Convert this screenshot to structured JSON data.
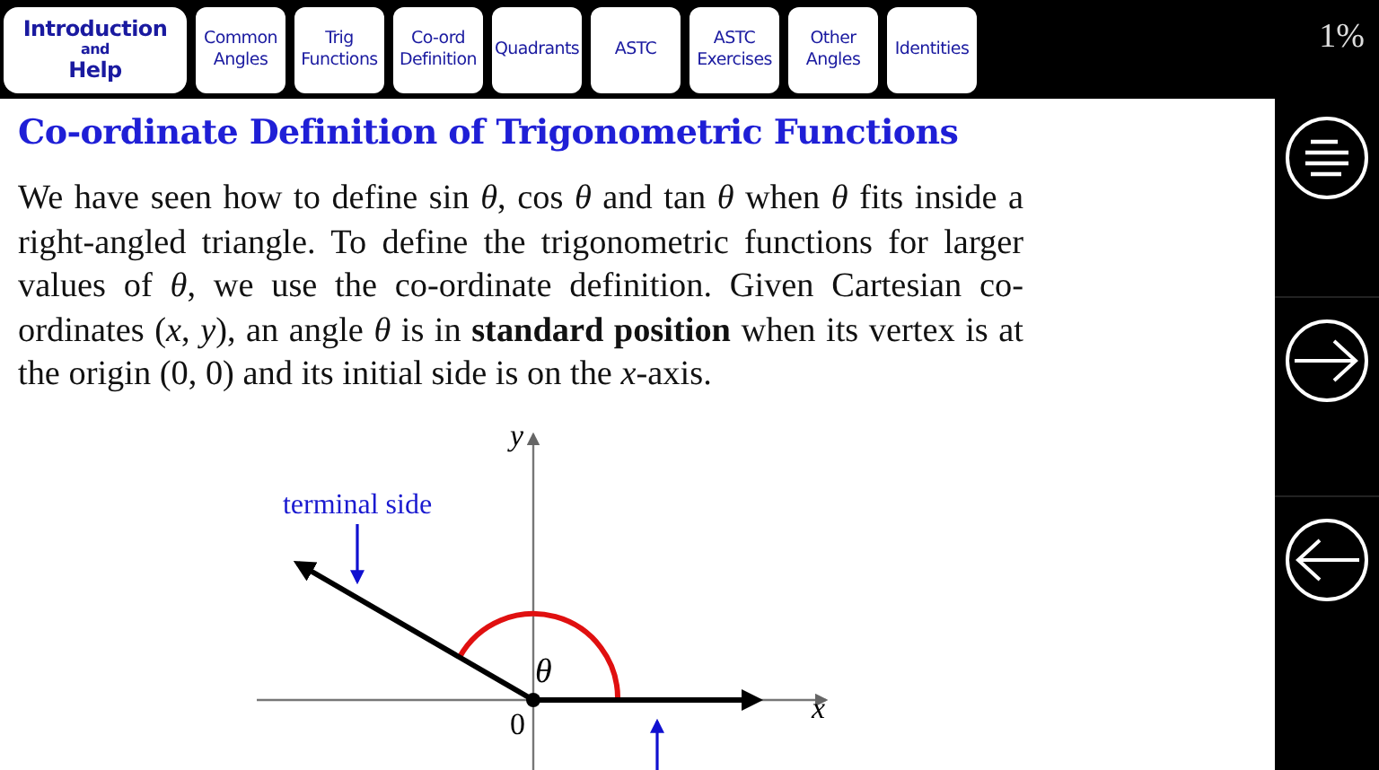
{
  "tabs": [
    {
      "lines": [
        "Introduction",
        "and",
        "Help"
      ],
      "kind": "wide"
    },
    {
      "lines": [
        "Common",
        "Angles"
      ],
      "kind": "normal"
    },
    {
      "lines": [
        "Trig",
        "Functions"
      ],
      "kind": "normal"
    },
    {
      "lines": [
        "Co-ord",
        "Definition"
      ],
      "kind": "normal"
    },
    {
      "lines": [
        "Quadrants"
      ],
      "kind": "normal"
    },
    {
      "lines": [
        "ASTC"
      ],
      "kind": "normal"
    },
    {
      "lines": [
        "ASTC",
        "Exercises"
      ],
      "kind": "normal"
    },
    {
      "lines": [
        "Other",
        "Angles"
      ],
      "kind": "normal"
    },
    {
      "lines": [
        "Identities"
      ],
      "kind": "normal"
    }
  ],
  "progress": "1%",
  "heading": "Co-ordinate Definition of Trigonometric Functions",
  "paragraph": "We have seen how to define sin *θ*, cos *θ* and tan *θ* when *θ* fits inside a right-angled triangle. To define the trigonometric functions for larger values of *θ*, we use the co-ordinate definition. Given Cartesian co-ordinates (*x*, *y*), an angle *θ* is in **standard position** when its vertex is at the origin (0, 0) and its initial side is on the *x*-axis.",
  "diagram": {
    "y_label": "y",
    "x_label": "x",
    "origin_label": "0",
    "angle_label": "θ",
    "terminal_label": "terminal side"
  }
}
